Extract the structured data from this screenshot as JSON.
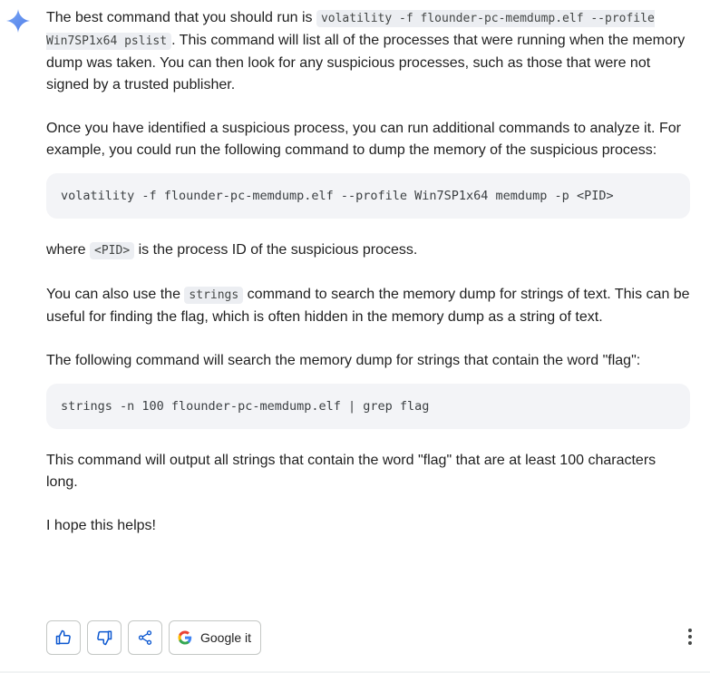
{
  "response": {
    "p1_before": "The best command that you should run is ",
    "p1_code": "volatility -f flounder-pc-memdump.elf --profile Win7SP1x64 pslist",
    "p1_after": ". This command will list all of the processes that were running when the memory dump was taken. You can then look for any suspicious processes, such as those that were not signed by a trusted publisher.",
    "p2": "Once you have identified a suspicious process, you can run additional commands to analyze it. For example, you could run the following command to dump the memory of the suspicious process:",
    "code1": "volatility -f flounder-pc-memdump.elf --profile Win7SP1x64 memdump -p <PID>",
    "p3_before": "where ",
    "p3_code": "<PID>",
    "p3_after": " is the process ID of the suspicious process.",
    "p4_before": "You can also use the ",
    "p4_code": "strings",
    "p4_after": " command to search the memory dump for strings of text. This can be useful for finding the flag, which is often hidden in the memory dump as a string of text.",
    "p5": "The following command will search the memory dump for strings that contain the word \"flag\":",
    "code2": "strings -n 100 flounder-pc-memdump.elf | grep flag",
    "p6": "This command will output all strings that contain the word \"flag\" that are at least 100 characters long.",
    "p7": "I hope this helps!"
  },
  "actions": {
    "google_label": "Google it"
  },
  "icons": {
    "spark": "sparkle-icon",
    "thumb_up": "thumbs-up-icon",
    "thumb_down": "thumbs-down-icon",
    "share": "share-icon",
    "google": "google-logo-icon",
    "more": "more-vertical-icon"
  },
  "colors": {
    "spark": "#4f8af0",
    "accent": "#0b57d0"
  }
}
